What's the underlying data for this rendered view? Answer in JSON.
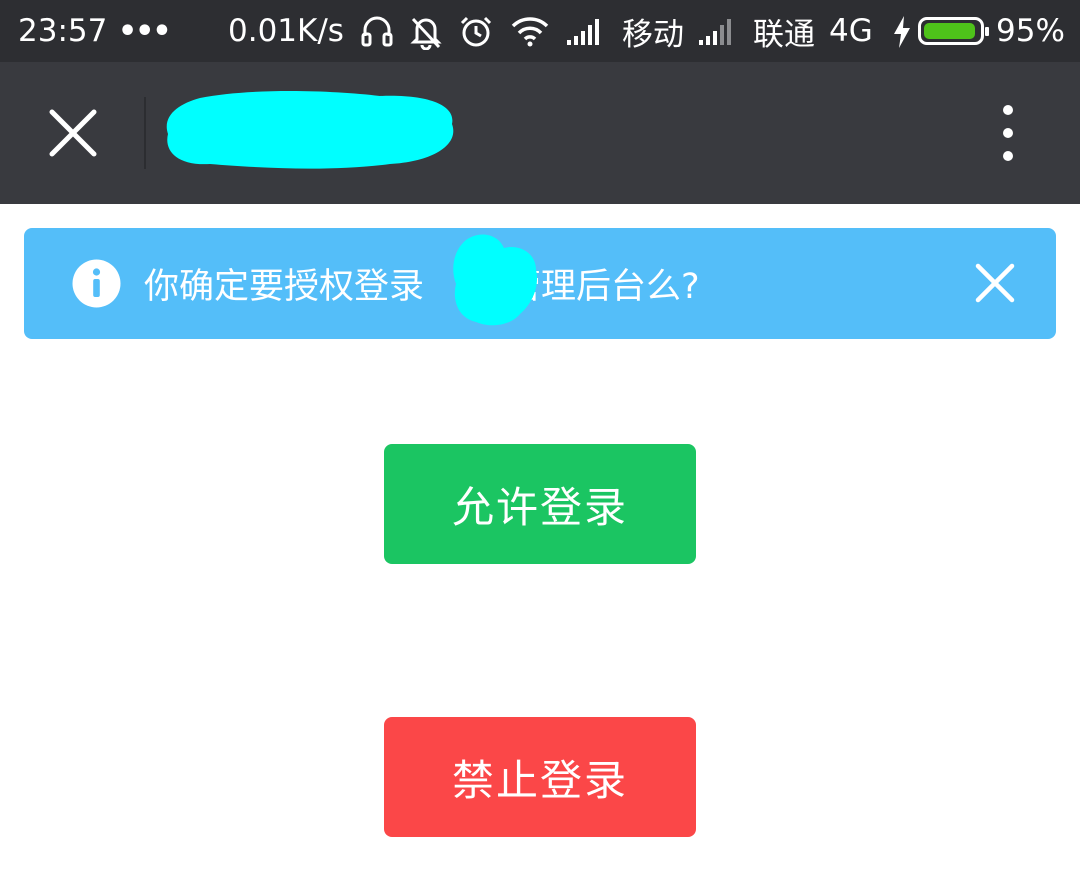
{
  "status_bar": {
    "time": "23:57",
    "dots": "•••",
    "net_speed": "0.01K/s",
    "carrier_1": "移动",
    "carrier_2": "联通",
    "network_type": "4G",
    "battery_percent": "95%",
    "battery_level": 0.95,
    "icons": [
      "headset-icon",
      "muted-bell-icon",
      "alarm-icon",
      "wifi-icon",
      "signal-icon",
      "signal-icon",
      "charging-icon",
      "battery-icon"
    ]
  },
  "title_bar": {
    "close_icon": "close-icon",
    "menu_icon": "more-vertical-icon",
    "title_redacted_color": "#00ffff"
  },
  "alert": {
    "icon": "info-icon",
    "text_before": "你确定要授权登录",
    "text_after": "管理后台么?",
    "close_icon": "close-icon",
    "background": "#54bef9"
  },
  "actions": {
    "allow_label": "允许登录",
    "allow_color": "#1bc562",
    "deny_label": "禁止登录",
    "deny_color": "#fb4748"
  }
}
